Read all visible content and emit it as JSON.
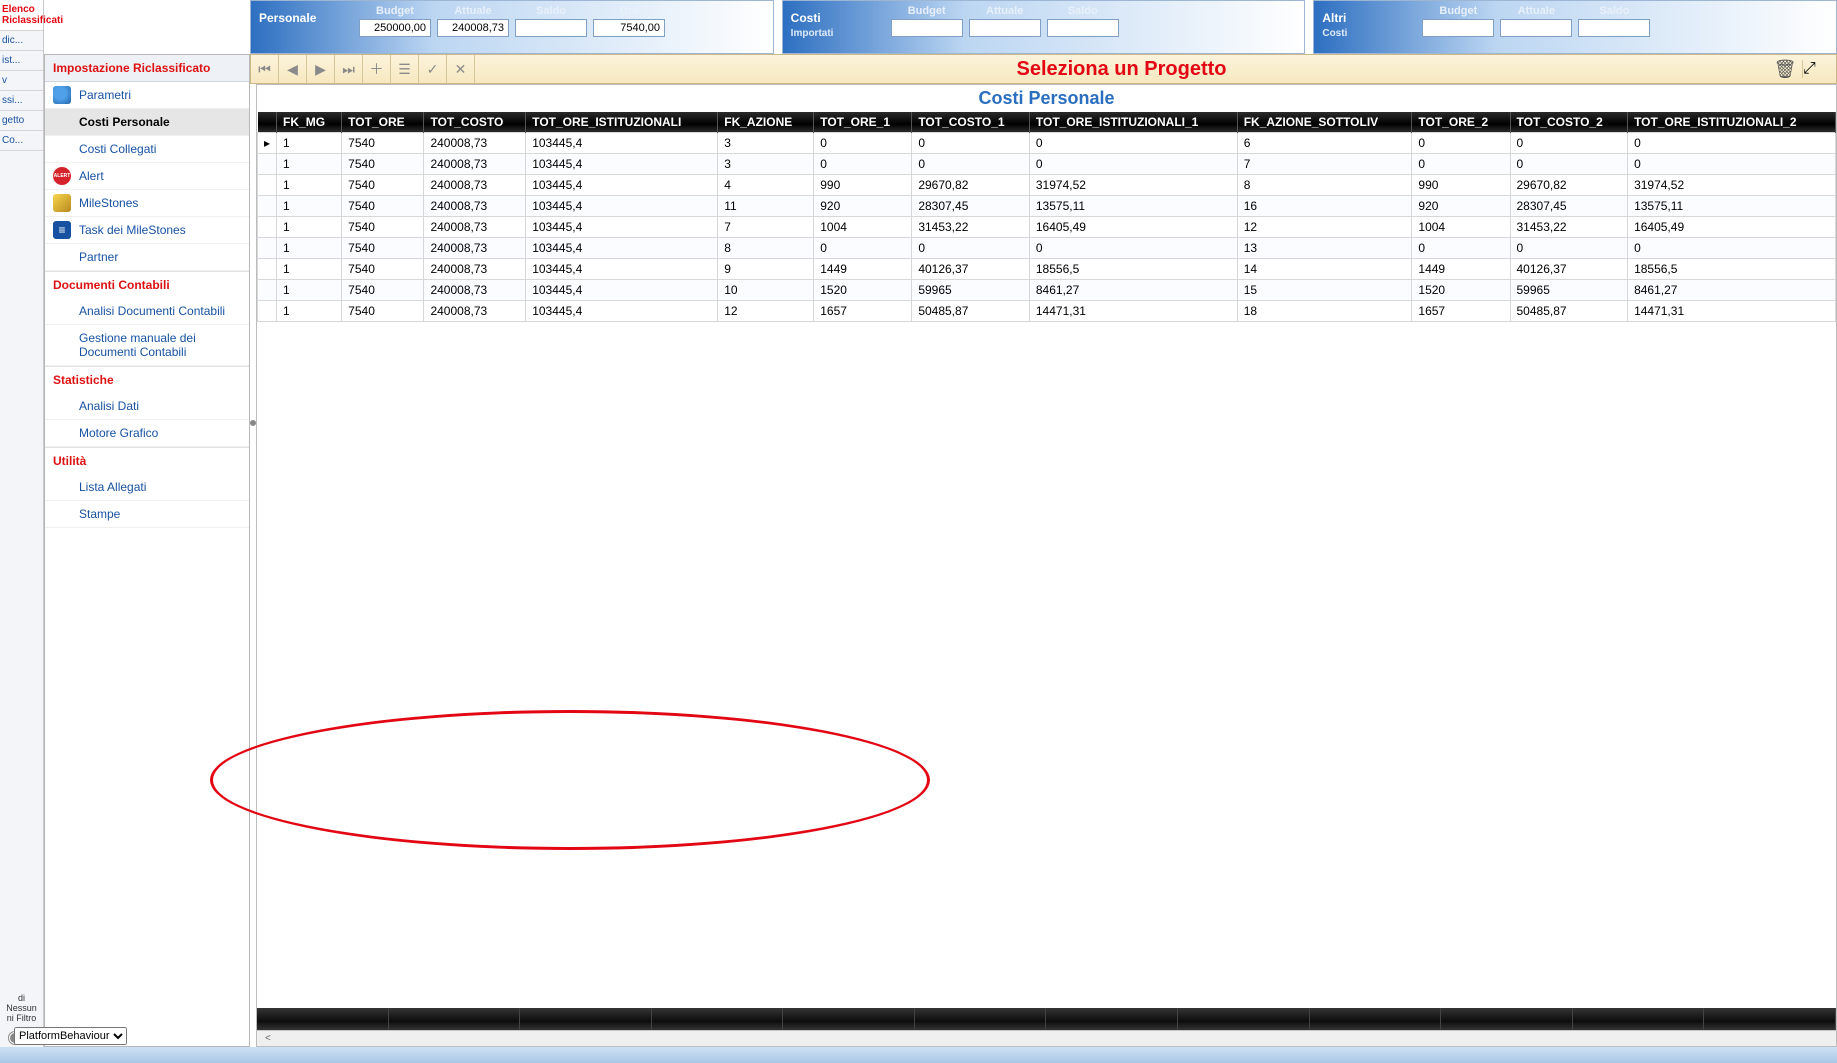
{
  "left_rail": {
    "tab_active": "Elenco Riclassificati",
    "tabs": [
      "dic...",
      "ist...",
      "v",
      "ssi...",
      "getto",
      "Co..."
    ],
    "bottom1": "di",
    "bottom2": "Nessun",
    "bottom3": "ni",
    "bottom4": "Filtro"
  },
  "sidebar": {
    "header": "Impostazione Riclassificato",
    "items": [
      {
        "label": "Parametri",
        "icon": "icon-param"
      },
      {
        "label": "Costi Personale",
        "active": true
      },
      {
        "label": "Costi Collegati"
      },
      {
        "label": "Alert",
        "icon": "icon-alert"
      },
      {
        "label": "MileStones",
        "icon": "icon-milestone"
      },
      {
        "label": "Task dei MileStones",
        "icon": "icon-task"
      },
      {
        "label": "Partner"
      }
    ],
    "section2": "Documenti Contabili",
    "items2": [
      {
        "label": "Analisi Documenti Contabili"
      },
      {
        "label": "Gestione manuale dei Documenti Contabili"
      }
    ],
    "section3": "Statistiche",
    "items3": [
      {
        "label": "Analisi Dati"
      },
      {
        "label": "Motore Grafico"
      }
    ],
    "section4": "Utilità",
    "items4": [
      {
        "label": "Lista Allegati"
      },
      {
        "label": "Stampe"
      }
    ]
  },
  "top": {
    "g1": {
      "title": "Personale",
      "cols": [
        {
          "label": "Budget",
          "value": "250000,00"
        },
        {
          "label": "Attuale",
          "value": "240008,73"
        },
        {
          "label": "Saldo",
          "value": ""
        },
        {
          "label": "Ore",
          "value": "7540,00"
        }
      ]
    },
    "g2": {
      "title": "Costi",
      "sub": "Importati",
      "cols": [
        {
          "label": "Budget",
          "value": ""
        },
        {
          "label": "Attuale",
          "value": ""
        },
        {
          "label": "Saldo",
          "value": ""
        }
      ]
    },
    "g3": {
      "title": "Altri",
      "sub": "Costi",
      "cols": [
        {
          "label": "Budget",
          "value": ""
        },
        {
          "label": "Attuale",
          "value": ""
        },
        {
          "label": "Saldo",
          "value": ""
        }
      ]
    }
  },
  "recbar": {
    "title": "Seleziona un Progetto"
  },
  "main": {
    "title": "Costi Personale",
    "columns": [
      "FK_MG",
      "TOT_ORE",
      "TOT_COSTO",
      "TOT_ORE_ISTITUZIONALI",
      "FK_AZIONE",
      "TOT_ORE_1",
      "TOT_COSTO_1",
      "TOT_ORE_ISTITUZIONALI_1",
      "FK_AZIONE_SOTTOLIV",
      "TOT_ORE_2",
      "TOT_COSTO_2",
      "TOT_ORE_ISTITUZIONALI_2"
    ],
    "rows": [
      [
        "1",
        "7540",
        "240008,73",
        "103445,4",
        "3",
        "0",
        "0",
        "0",
        "6",
        "0",
        "0",
        "0"
      ],
      [
        "1",
        "7540",
        "240008,73",
        "103445,4",
        "3",
        "0",
        "0",
        "0",
        "7",
        "0",
        "0",
        "0"
      ],
      [
        "1",
        "7540",
        "240008,73",
        "103445,4",
        "4",
        "990",
        "29670,82",
        "31974,52",
        "8",
        "990",
        "29670,82",
        "31974,52"
      ],
      [
        "1",
        "7540",
        "240008,73",
        "103445,4",
        "11",
        "920",
        "28307,45",
        "13575,11",
        "16",
        "920",
        "28307,45",
        "13575,11"
      ],
      [
        "1",
        "7540",
        "240008,73",
        "103445,4",
        "7",
        "1004",
        "31453,22",
        "16405,49",
        "12",
        "1004",
        "31453,22",
        "16405,49"
      ],
      [
        "1",
        "7540",
        "240008,73",
        "103445,4",
        "8",
        "0",
        "0",
        "0",
        "13",
        "0",
        "0",
        "0"
      ],
      [
        "1",
        "7540",
        "240008,73",
        "103445,4",
        "9",
        "1449",
        "40126,37",
        "18556,5",
        "14",
        "1449",
        "40126,37",
        "18556,5"
      ],
      [
        "1",
        "7540",
        "240008,73",
        "103445,4",
        "10",
        "1520",
        "59965",
        "8461,27",
        "15",
        "1520",
        "59965",
        "8461,27"
      ],
      [
        "1",
        "7540",
        "240008,73",
        "103445,4",
        "12",
        "1657",
        "50485,87",
        "14471,31",
        "18",
        "1657",
        "50485,87",
        "14471,31"
      ]
    ]
  },
  "osbar": {
    "combo": "PlatformBehaviour"
  }
}
